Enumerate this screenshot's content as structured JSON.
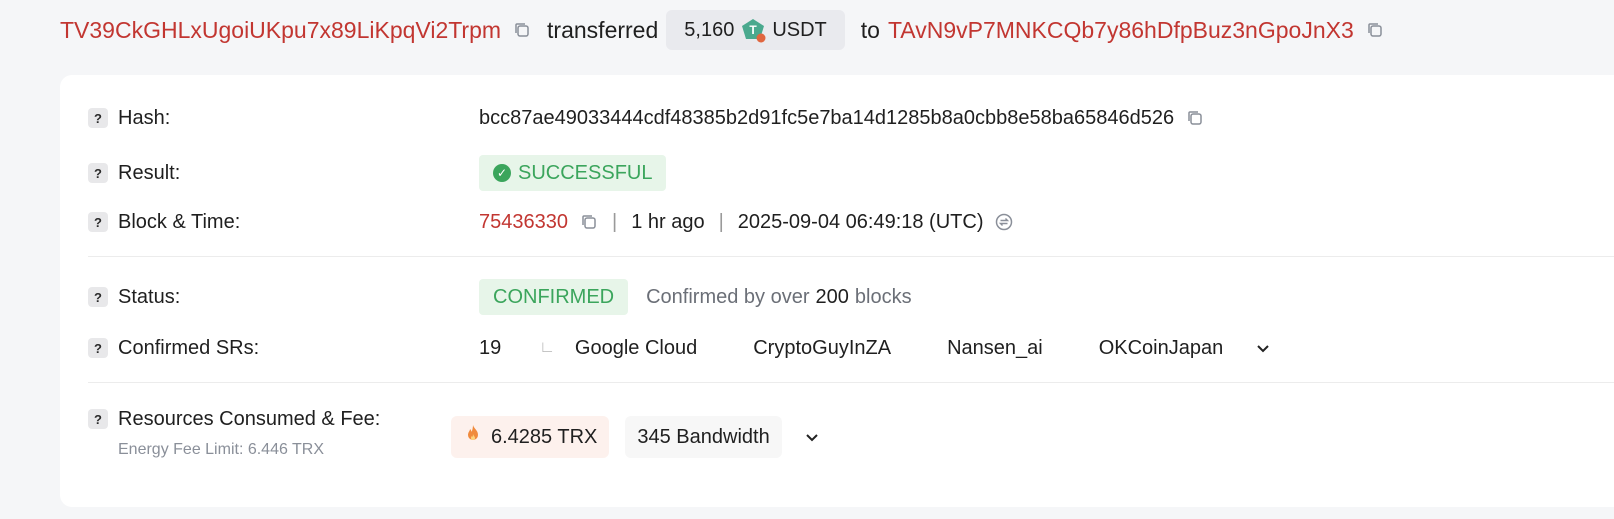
{
  "header": {
    "from_address": "TV39CkGHLxUgoiUKpu7x89LiKpqVi2Trpm",
    "transferred_text": "transferred",
    "amount": "5,160",
    "token": "USDT",
    "to_text": "to",
    "to_address": "TAvN9vP7MNKCQb7y86hDfpBuz3nGpoJnX3",
    "icons": {
      "copy": "copy-icon",
      "token": "usdt-token-icon"
    }
  },
  "details": {
    "hash": {
      "label": "Hash:",
      "value": "bcc87ae49033444cdf48385b2d91fc5e7ba14d1285b8a0cbb8e58ba65846d526"
    },
    "result": {
      "label": "Result:",
      "value": "SUCCESSFUL"
    },
    "block_time": {
      "label": "Block & Time:",
      "block": "75436330",
      "ago": "1 hr ago",
      "timestamp": "2025-09-04 06:49:18 (UTC)"
    },
    "status": {
      "label": "Status:",
      "value": "CONFIRMED",
      "confirmed_prefix": "Confirmed by over",
      "confirmed_count": "200",
      "confirmed_suffix": "blocks"
    },
    "confirmed_srs": {
      "label": "Confirmed SRs:",
      "count": "19",
      "items": [
        "Google Cloud",
        "CryptoGuyInZA",
        "Nansen_ai",
        "OKCoinJapan"
      ]
    },
    "resources": {
      "label": "Resources Consumed & Fee:",
      "energy_fee_limit": "Energy Fee Limit: 6.446 TRX",
      "trx_fee": "6.4285 TRX",
      "bandwidth": "345 Bandwidth"
    }
  },
  "colors": {
    "address": "#c23631",
    "success": "#3ba55c",
    "card_bg": "#ffffff",
    "page_bg": "#f5f6f8"
  }
}
